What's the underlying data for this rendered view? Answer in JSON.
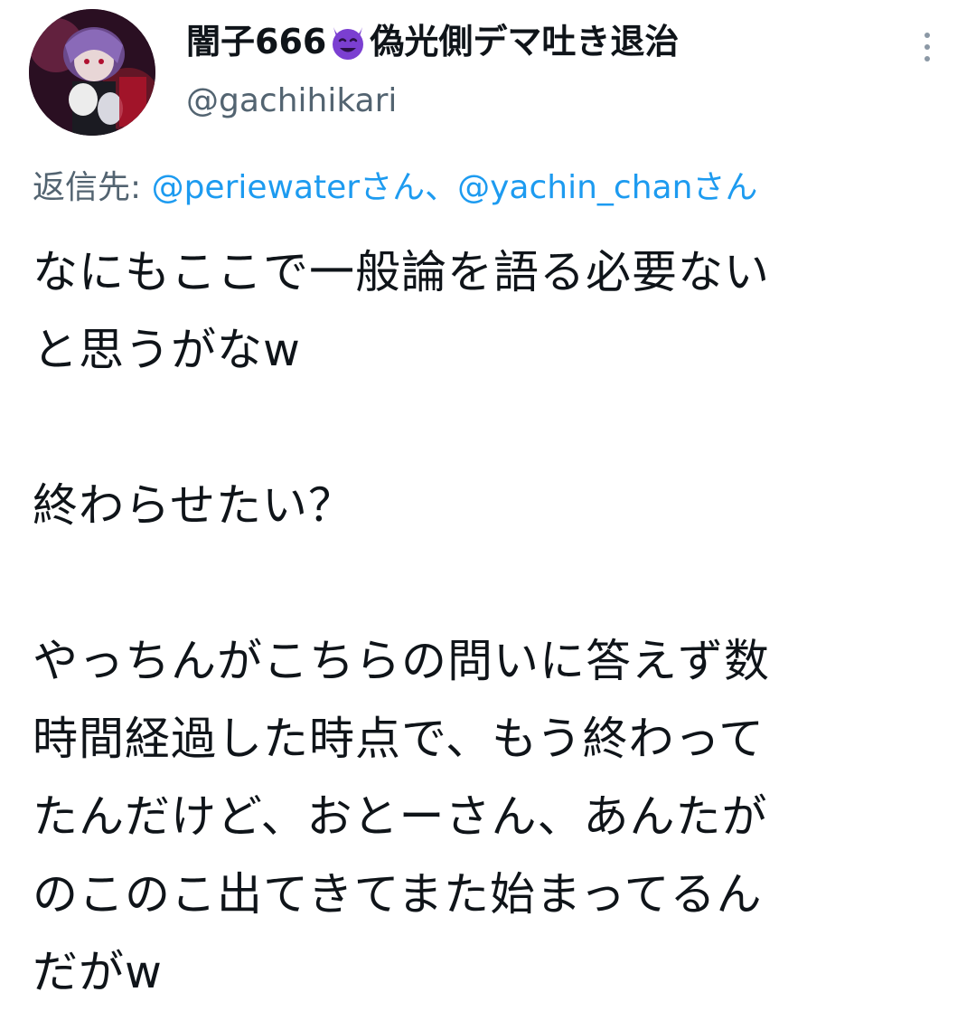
{
  "author": {
    "display_name_before": "闇子666",
    "display_name_emoji": "smiling-devil-icon",
    "display_name_after": "偽光側デマ吐き退治",
    "handle": "@gachihikari"
  },
  "reply": {
    "prefix": "返信先: ",
    "user1": "@periewater",
    "suffix1": "さん、",
    "user2": "@yachin_chan",
    "suffix2": "さん"
  },
  "tweet": {
    "lines": [
      "なにもここで一般論を語る必要ない",
      "と思うがなw",
      "",
      "終わらせたい？",
      "",
      "やっちんがこちらの問いに答えず数",
      "時間経過した時点で、もう終わって",
      "たんだけど、おとーさん、あんたが",
      "のこのこ出てきてまた始まってるん",
      "だがw"
    ]
  },
  "colors": {
    "text": "#0f1419",
    "secondary": "#536471",
    "link": "#1d9bf0",
    "devil": "#7b3fd1"
  },
  "icons": {
    "more": "more-vertical-icon",
    "avatar": "avatar-image"
  }
}
